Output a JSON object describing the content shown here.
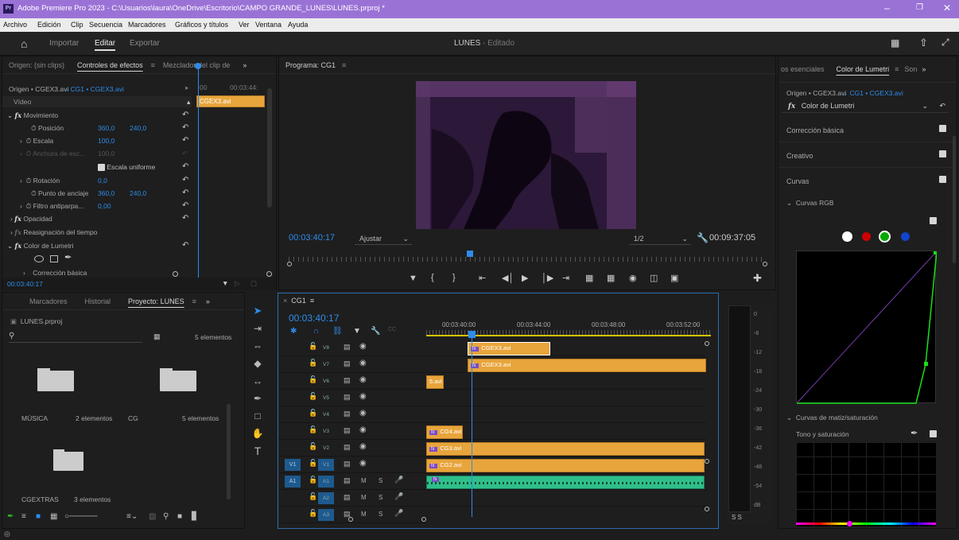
{
  "window": {
    "title": "Adobe Premiere Pro 2023 - C:\\Usuarios\\laura\\OneDrive\\Escritorio\\CAMPO GRANDE_LUNES\\LUNES.prproj *",
    "app_badge": "Pr"
  },
  "menu": [
    "Archivo",
    "Edición",
    "Clip",
    "Secuencia",
    "Marcadores",
    "Gráficos y títulos",
    "Ver",
    "Ventana",
    "Ayuda"
  ],
  "workspace": {
    "tabs": [
      "Importar",
      "Editar",
      "Exportar"
    ],
    "active": "Editar",
    "project": "LUNES",
    "status": "- Editado"
  },
  "source_panel": {
    "tabs": [
      "Origen: (sin clips)",
      "Controles de efectos",
      "Mezclador del clip de"
    ],
    "origin": "Origen • CGEX3.avi",
    "seq_clip": "CG1 • CGEX3.avi",
    "tc_start": "00",
    "tc_end": "00:03:44:",
    "video_label": "Vídeo",
    "clip_label": "CGEX3.avi",
    "props": {
      "movimiento": "Movimiento",
      "posicion": "Posición",
      "pos_x": "360,0",
      "pos_y": "240,0",
      "escala": "Escala",
      "escala_val": "100,0",
      "anchura": "Anchura de esc...",
      "anchura_val": "100,0",
      "escala_uniforme": "Escala uniforme",
      "rotacion": "Rotación",
      "rot_val": "0,0",
      "anclaje": "Punto de anclaje",
      "anc_x": "360,0",
      "anc_y": "240,0",
      "filtro": "Filtro antiparpa...",
      "filtro_val": "0,00",
      "opacidad": "Opacidad",
      "reasig": "Reasignación del tiempo",
      "lumetri": "Color de Lumetri",
      "correccion": "Corrección básica"
    },
    "timecode": "00:03:40:17"
  },
  "program": {
    "title": "Programa: CG1",
    "timecode": "00:03:40:17",
    "fit": "Ajustar",
    "quality": "1/2",
    "duration": "00:09:37:05"
  },
  "right_panel": {
    "tabs": [
      "os esenciales",
      "Color de Lumetri",
      "Son"
    ],
    "origin": "Origen • CGEX3.avi",
    "seq": "CG1 • CGEX3.avi",
    "effect": "Color de Lumetri",
    "sections": [
      "Corrección básica",
      "Creativo",
      "Curvas"
    ],
    "curves_rgb": "Curvas RGB",
    "hue_sat": "Curvas de matiz/saturación",
    "tono": "Tono y saturación"
  },
  "project": {
    "tabs": [
      "Marcadores",
      "Historial",
      "Proyecto: LUNES"
    ],
    "file": "LUNES.prproj",
    "count": "5 elementos",
    "bins": [
      {
        "name": "MÚSICA",
        "count": "2 elementos"
      },
      {
        "name": "CG",
        "count": "5 elementos"
      },
      {
        "name": "CGEXTRAS",
        "count": "3 elementos"
      }
    ]
  },
  "timeline": {
    "title": "CG1",
    "timecode": "00:03:40:17",
    "ruler": [
      "00:03:40:00",
      "00:03:44:00",
      "00:03:48:00",
      "00:03:52:00"
    ],
    "tracks": [
      {
        "id": "V8",
        "type": "v"
      },
      {
        "id": "V7",
        "type": "v"
      },
      {
        "id": "V6",
        "type": "v"
      },
      {
        "id": "V5",
        "type": "v"
      },
      {
        "id": "V4",
        "type": "v"
      },
      {
        "id": "V3",
        "type": "v"
      },
      {
        "id": "V2",
        "type": "v"
      },
      {
        "id": "V1",
        "type": "v"
      },
      {
        "id": "A1",
        "type": "a"
      },
      {
        "id": "A2",
        "type": "a"
      },
      {
        "id": "A3",
        "type": "a"
      }
    ],
    "clips": [
      {
        "label": "CGEX3.avi",
        "track": 0
      },
      {
        "label": "CGEX3.avi",
        "track": 1
      },
      {
        "label": "5.avi",
        "track": 2
      },
      {
        "label": "CG4.avi",
        "track": 5
      },
      {
        "label": "CG3.avi",
        "track": 6
      },
      {
        "label": "CG2.avi",
        "track": 7
      }
    ],
    "ms": [
      "M",
      "S"
    ],
    "solo": "S S"
  },
  "meter": {
    "labels": [
      "0",
      "-6",
      "-12",
      "-18",
      "-24",
      "-30",
      "-36",
      "-42",
      "-48",
      "-54",
      "dB"
    ]
  }
}
